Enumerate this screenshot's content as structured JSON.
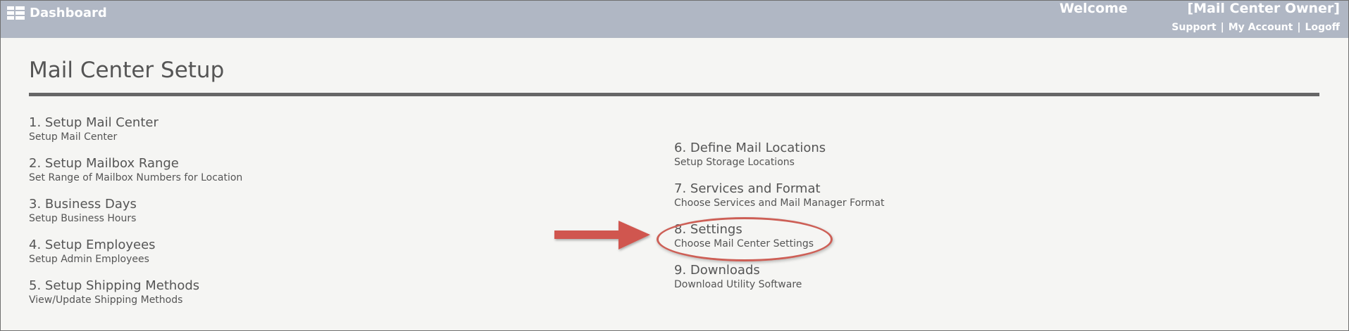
{
  "header": {
    "dashboard_label": "Dashboard",
    "welcome_label": "Welcome",
    "user_label": "[Mail Center Owner]",
    "support_label": "Support",
    "separator": "|",
    "account_label": "My Account",
    "logoff_label": "Logoff"
  },
  "page": {
    "title": "Mail Center Setup"
  },
  "left_items": [
    {
      "title": "1. Setup Mail Center",
      "subtitle": "Setup Mail Center"
    },
    {
      "title": "2. Setup Mailbox Range",
      "subtitle": "Set Range of Mailbox Numbers for Location"
    },
    {
      "title": "3. Business Days",
      "subtitle": "Setup Business Hours"
    },
    {
      "title": "4. Setup Employees",
      "subtitle": "Setup Admin Employees"
    },
    {
      "title": "5. Setup Shipping Methods",
      "subtitle": "View/Update Shipping Methods"
    }
  ],
  "right_items": [
    {
      "title": "6. Define Mail Locations",
      "subtitle": "Setup Storage Locations"
    },
    {
      "title": "7. Services and Format",
      "subtitle": "Choose Services and Mail Manager Format"
    },
    {
      "title": "8. Settings",
      "subtitle": "Choose Mail Center Settings"
    },
    {
      "title": "9. Downloads",
      "subtitle": "Download Utility Software"
    }
  ],
  "colors": {
    "header_bg": "#b0b7c4",
    "annotation_red": "#d0574f",
    "rule": "#666666"
  },
  "icons": {
    "dashboard": "grid-icon",
    "annotation": "arrow-annotation-icon"
  }
}
